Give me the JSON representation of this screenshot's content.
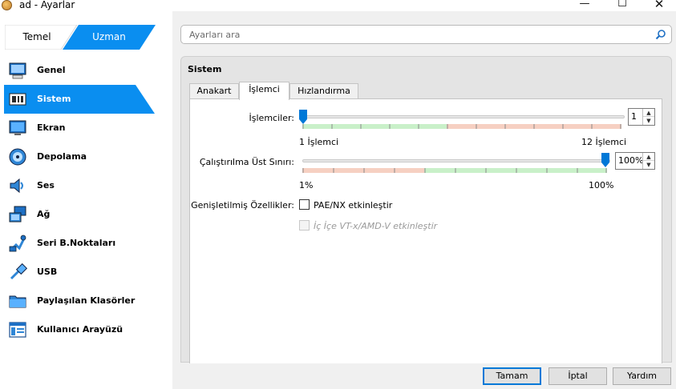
{
  "window": {
    "title": "ad - Ayarlar",
    "controls": {
      "minimize": "—",
      "maximize": "☐",
      "close": "✕"
    }
  },
  "mode": {
    "basic": "Temel",
    "expert": "Uzman"
  },
  "sidebar": {
    "items": [
      {
        "label": "Genel",
        "icon": "general-icon"
      },
      {
        "label": "Sistem",
        "icon": "system-icon",
        "selected": true
      },
      {
        "label": "Ekran",
        "icon": "display-icon"
      },
      {
        "label": "Depolama",
        "icon": "storage-icon"
      },
      {
        "label": "Ses",
        "icon": "audio-icon"
      },
      {
        "label": "Ağ",
        "icon": "network-icon"
      },
      {
        "label": "Seri B.Noktaları",
        "icon": "serial-ports-icon"
      },
      {
        "label": "USB",
        "icon": "usb-icon"
      },
      {
        "label": "Paylaşılan Klasörler",
        "icon": "shared-folders-icon"
      },
      {
        "label": "Kullanıcı Arayüzü",
        "icon": "user-interface-icon"
      }
    ]
  },
  "search": {
    "placeholder": "Ayarları ara",
    "value": ""
  },
  "panel": {
    "title": "Sistem",
    "tabs": [
      {
        "label": "Anakart"
      },
      {
        "label": "İşlemci",
        "active": true
      },
      {
        "label": "Hızlandırma"
      }
    ],
    "processors": {
      "label": "İşlemciler:",
      "value": "1",
      "min": 1,
      "max": 12,
      "min_label": "1 İşlemci",
      "max_label": "12 İşlemci"
    },
    "execution_cap": {
      "label": "Çalıştırılma Üst Sınırı:",
      "value": "100%",
      "min": 1,
      "max": 100,
      "min_label": "1%",
      "max_label": "100%"
    },
    "extended": {
      "label": "Genişletilmiş Özellikler:",
      "pae_nx": {
        "label": "PAE/NX etkinleştir",
        "checked": false
      },
      "nested_vtx": {
        "label": "İç İçe VT-x/AMD-V etkinleştir",
        "checked": false,
        "enabled": false
      }
    }
  },
  "buttons": {
    "ok": "Tamam",
    "cancel": "İptal",
    "help": "Yardım"
  },
  "colors": {
    "accent": "#0078d7",
    "green_zone": "#c9f0c9",
    "red_zone": "#f6d0c2"
  }
}
